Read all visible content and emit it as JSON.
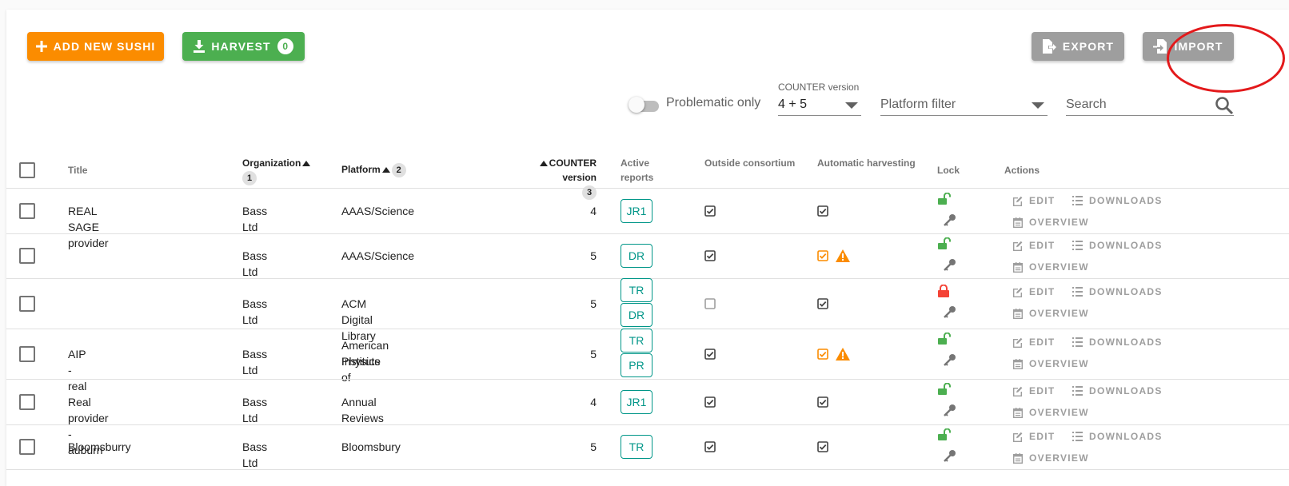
{
  "toolbar": {
    "add_label": "Add new SUSHI",
    "harvest_label": "Harvest",
    "harvest_count": "0",
    "export_label": "Export",
    "import_label": "Import"
  },
  "filters": {
    "problematic_label": "Problematic only",
    "counter_label": "COUNTER version",
    "counter_value": "4 + 5",
    "platform_placeholder": "Platform filter",
    "search_placeholder": "Search"
  },
  "table": {
    "headers": {
      "title": "Title",
      "organization": "Organization",
      "organization_sort": "1",
      "platform": "Platform",
      "platform_sort": "2",
      "counter": "COUNTER version",
      "counter_sort": "3",
      "active_reports_1": "Active",
      "active_reports_2": "reports",
      "outside": "Outside consortium",
      "automatic": "Automatic harvesting",
      "lock": "Lock",
      "actions": "Actions"
    },
    "action_labels": {
      "edit": "Edit",
      "downloads": "Downloads",
      "overview": "Overview"
    },
    "rows": [
      {
        "title": "REAL SAGE provider",
        "organization": "Bass Ltd",
        "platform": "AAAS/Science",
        "platform_line2": "",
        "counter": "4",
        "reports": [
          "JR1"
        ],
        "outside": true,
        "automatic": true,
        "automatic_warning": false,
        "locked": false
      },
      {
        "title": "",
        "organization": "Bass Ltd",
        "platform": "AAAS/Science",
        "platform_line2": "",
        "counter": "5",
        "reports": [
          "DR"
        ],
        "outside": true,
        "automatic": true,
        "automatic_warning": true,
        "locked": false
      },
      {
        "title": "",
        "organization": "Bass Ltd",
        "platform": "ACM Digital Library",
        "platform_line2": "",
        "counter": "5",
        "reports": [
          "TR",
          "DR"
        ],
        "outside": false,
        "automatic": true,
        "automatic_warning": false,
        "locked": true
      },
      {
        "title": "AIP - real",
        "organization": "Bass Ltd",
        "platform": "American Institute of",
        "platform_line2": "Physics",
        "counter": "5",
        "reports": [
          "TR",
          "PR"
        ],
        "outside": true,
        "automatic": true,
        "automatic_warning": true,
        "locked": false
      },
      {
        "title": "Real provider - auburn",
        "organization": "Bass Ltd",
        "platform": "Annual Reviews",
        "platform_line2": "",
        "counter": "4",
        "reports": [
          "JR1"
        ],
        "outside": true,
        "automatic": true,
        "automatic_warning": false,
        "locked": false
      },
      {
        "title": "Bloomsburry",
        "organization": "Bass Ltd",
        "platform": "Bloomsbury",
        "platform_line2": "",
        "counter": "5",
        "reports": [
          "TR"
        ],
        "outside": true,
        "automatic": true,
        "automatic_warning": false,
        "locked": false
      }
    ]
  },
  "colors": {
    "add_button": "#fb8c00",
    "harvest_button": "#4caf50",
    "neutral_button": "#9e9e9e",
    "report_chip": "#009688",
    "warning": "#fb8c00",
    "unlocked": "#4caf50",
    "locked": "#f44336",
    "annotation_ring": "#e3191b"
  },
  "icons": {
    "add": "plus-icon",
    "harvest": "download-icon",
    "export": "file-export-icon",
    "import": "file-import-icon",
    "search": "magnify-icon",
    "edit": "pencil-box-icon",
    "downloads": "list-icon",
    "overview": "calendar-icon",
    "lock_open": "lock-open-icon",
    "lock_closed": "lock-icon",
    "key": "key-icon",
    "warning": "alert-triangle-icon"
  }
}
